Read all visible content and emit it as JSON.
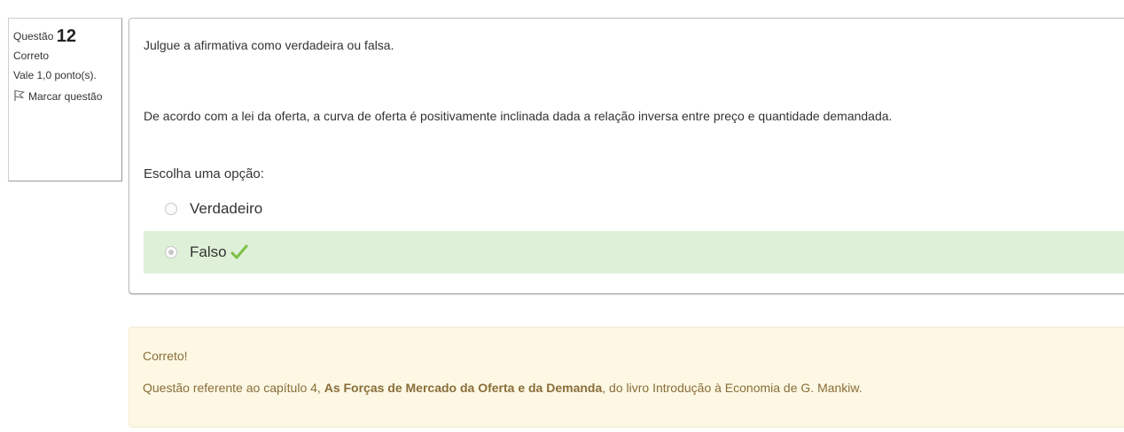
{
  "question_info": {
    "label": "Questão",
    "number": "12",
    "state": "Correto",
    "grade": "Vale 1,0 ponto(s).",
    "flag_label": "Marcar questão"
  },
  "question": {
    "intro": "Julgue a afirmativa como verdadeira ou falsa.",
    "text": "De acordo com a lei da oferta, a curva de oferta é positivamente inclinada dada a relação inversa entre preço e quantidade demandada.",
    "prompt": "Escolha uma opção:",
    "options": [
      {
        "label": "Verdadeiro",
        "selected": false
      },
      {
        "label": "Falso",
        "selected": true,
        "correct": true
      }
    ]
  },
  "feedback": {
    "title": "Correto!",
    "text_before": "Questão referente ao capítulo 4, ",
    "text_bold": "As Forças de Mercado da Oferta e da Demanda",
    "text_after": ", do livro Introdução à Economia de G. Mankiw."
  },
  "colors": {
    "correct_bg": "#dff0d8",
    "feedback_bg": "#fcf8e3",
    "feedback_text": "#8a6d3b",
    "check": "#7bc043"
  },
  "icons": {
    "flag": "flag-outline-icon",
    "check": "check-mark-icon"
  }
}
